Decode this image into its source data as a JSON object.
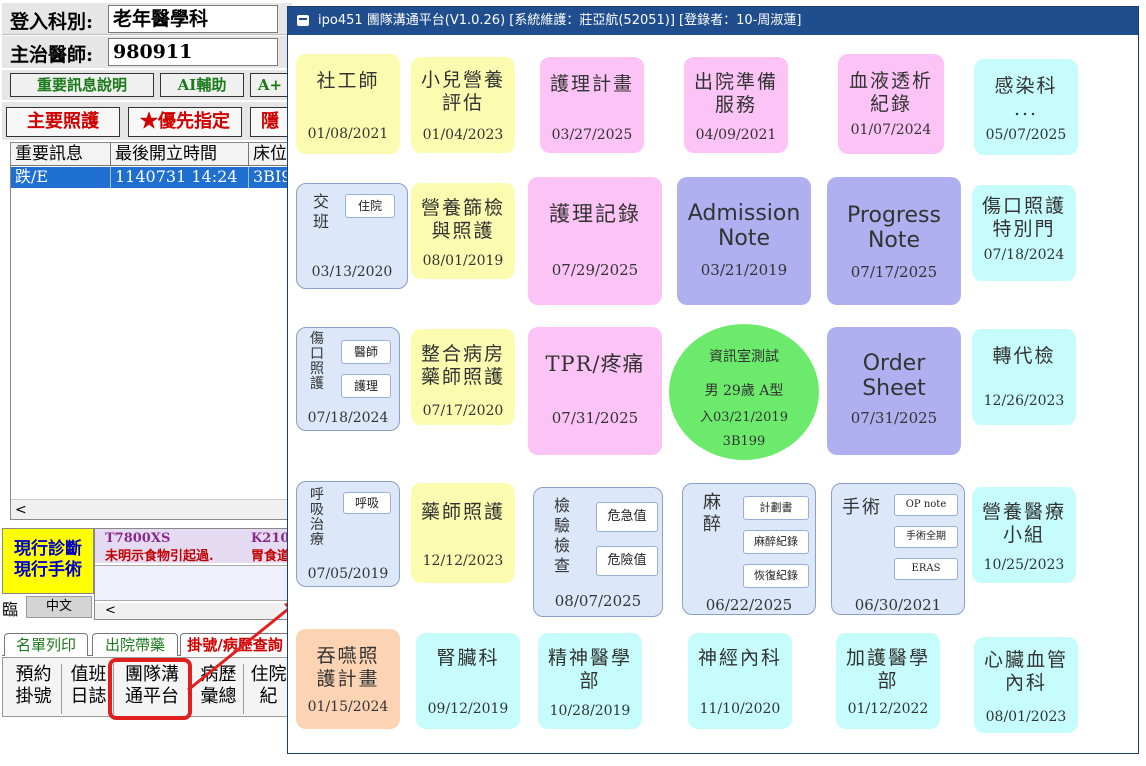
{
  "bg_app": {
    "dept_label": "登入科別:",
    "dept_value": "老年醫學科",
    "doctor_label": "主治醫師:",
    "doctor_value": "980911",
    "btn_important_info": "重要訊息說明",
    "btn_ai_assist": "AI輔助",
    "btn_aplus": "A+",
    "btn_main_care": "主要照護",
    "btn_priority": "★優先指定",
    "btn_third": "隱",
    "list_headers": [
      "重要訊息",
      "最後開立時間",
      "床位"
    ],
    "list_row": [
      "跌/E",
      "1140731 14:24",
      "3BI9"
    ],
    "scroll_left": "<",
    "current_label": "現行診斷\n現行手術",
    "diag_code_1": "T7800XS",
    "diag_code_2": "K210",
    "diag_text_1": "未明示食物引起過.",
    "diag_text_2": "胃食道",
    "ime_label": "臨",
    "ime_value": "中文",
    "tabs": [
      "名單列印",
      "出院帶藥",
      "掛號/病歷查詢"
    ],
    "bottom_buttons": [
      {
        "label": "預約\n掛號"
      },
      {
        "label": "值班\n日誌"
      },
      {
        "label": "團隊溝\n通平台"
      },
      {
        "label": "病歷\n彙總"
      },
      {
        "label": "住院\n紀"
      }
    ]
  },
  "window": {
    "title": "ipo451 團隊溝通平台(V1.0.26) [系統維護：莊亞航(52051)] [登錄者：10-周淑蓮]"
  },
  "tiles": {
    "social_worker": {
      "title": "社工師",
      "date": "01/08/2021"
    },
    "pediatric_nutrition": {
      "title": "小兒營養\n評估",
      "date": "01/04/2023"
    },
    "nursing_plan": {
      "title": "護理計畫",
      "date": "03/27/2025"
    },
    "discharge_prep": {
      "title": "出院準備\n服務",
      "date": "04/09/2021"
    },
    "dialysis": {
      "title": "血液透析\n紀錄",
      "date": "01/07/2024"
    },
    "infection": {
      "title": "感染科\n...",
      "date": "05/07/2025"
    },
    "handover": {
      "title": "交\n班",
      "sub": "住院",
      "date": "03/13/2020"
    },
    "nutrition_screen": {
      "title": "營養篩檢\n與照護",
      "date": "08/01/2019"
    },
    "nursing_record": {
      "title": "護理記錄",
      "date": "07/29/2025"
    },
    "admission_note": {
      "title": "Admission\nNote",
      "date": "03/21/2019"
    },
    "progress_note": {
      "title": "Progress\nNote",
      "date": "07/17/2025"
    },
    "wound_special": {
      "title": "傷口照護\n特別門",
      "date": "07/18/2024"
    },
    "wound_care": {
      "title": "傷\n口\n照\n護",
      "sub1": "醫師",
      "sub2": "護理",
      "date": "07/18/2024"
    },
    "pharmacist_ward": {
      "title": "整合病房\n藥師照護",
      "date": "07/17/2020"
    },
    "tpr_pain": {
      "title": "TPR/疼痛",
      "date": "07/31/2025"
    },
    "patient": {
      "line1": "資訊室測試",
      "line2": "男 29歲 A型",
      "line3": "入03/21/2019",
      "line4": "3B199"
    },
    "order_sheet": {
      "title": "Order\nSheet",
      "date": "07/31/2025"
    },
    "transfer_check": {
      "title": "轉代檢",
      "date": "12/26/2023"
    },
    "respiratory": {
      "title": "呼\n吸\n治\n療",
      "sub": "呼吸",
      "date": "07/05/2019"
    },
    "pharmacist_care": {
      "title": "藥師照護",
      "date": "12/12/2023"
    },
    "lab_check": {
      "title": "檢\n驗\n檢\n查",
      "sub1": "危急值",
      "sub2": "危險值",
      "date": "08/07/2025"
    },
    "anesthesia": {
      "title": "麻\n醉",
      "sub1": "計劃書",
      "sub2": "麻醉紀錄",
      "sub3": "恢復紀錄",
      "date": "06/22/2025"
    },
    "surgery": {
      "title": "手術",
      "sub1": "OP note",
      "sub2": "手術全期",
      "sub3": "ERAS",
      "date": "06/30/2021"
    },
    "nutrition_team": {
      "title": "營養醫療\n小組",
      "date": "10/25/2023"
    },
    "swallowing": {
      "title": "吞嚥照\n護計畫",
      "date": "01/15/2024"
    },
    "nephrology": {
      "title": "腎臟科",
      "date": "09/12/2019"
    },
    "psychiatry": {
      "title": "精神醫學\n部",
      "date": "10/28/2019"
    },
    "neurology": {
      "title": "神經內科",
      "date": "11/10/2020"
    },
    "critical_care": {
      "title": "加護醫學\n部",
      "date": "01/12/2022"
    },
    "cardiology": {
      "title": "心臟血管\n內科",
      "date": "08/01/2023"
    }
  },
  "colors": {
    "titlebar": "#1f4d8e",
    "yellow_tile": "#fcfcb0",
    "pink_tile": "#fcc4f6",
    "cyan_tile": "#c6fcfc",
    "lavender_tile": "#b0b0f0",
    "peach_tile": "#fcd4b4",
    "patient_circle": "#6cea6c",
    "highlight_red": "#e02020"
  },
  "icons": [
    "window-app-icon",
    "annotation-arrow"
  ]
}
